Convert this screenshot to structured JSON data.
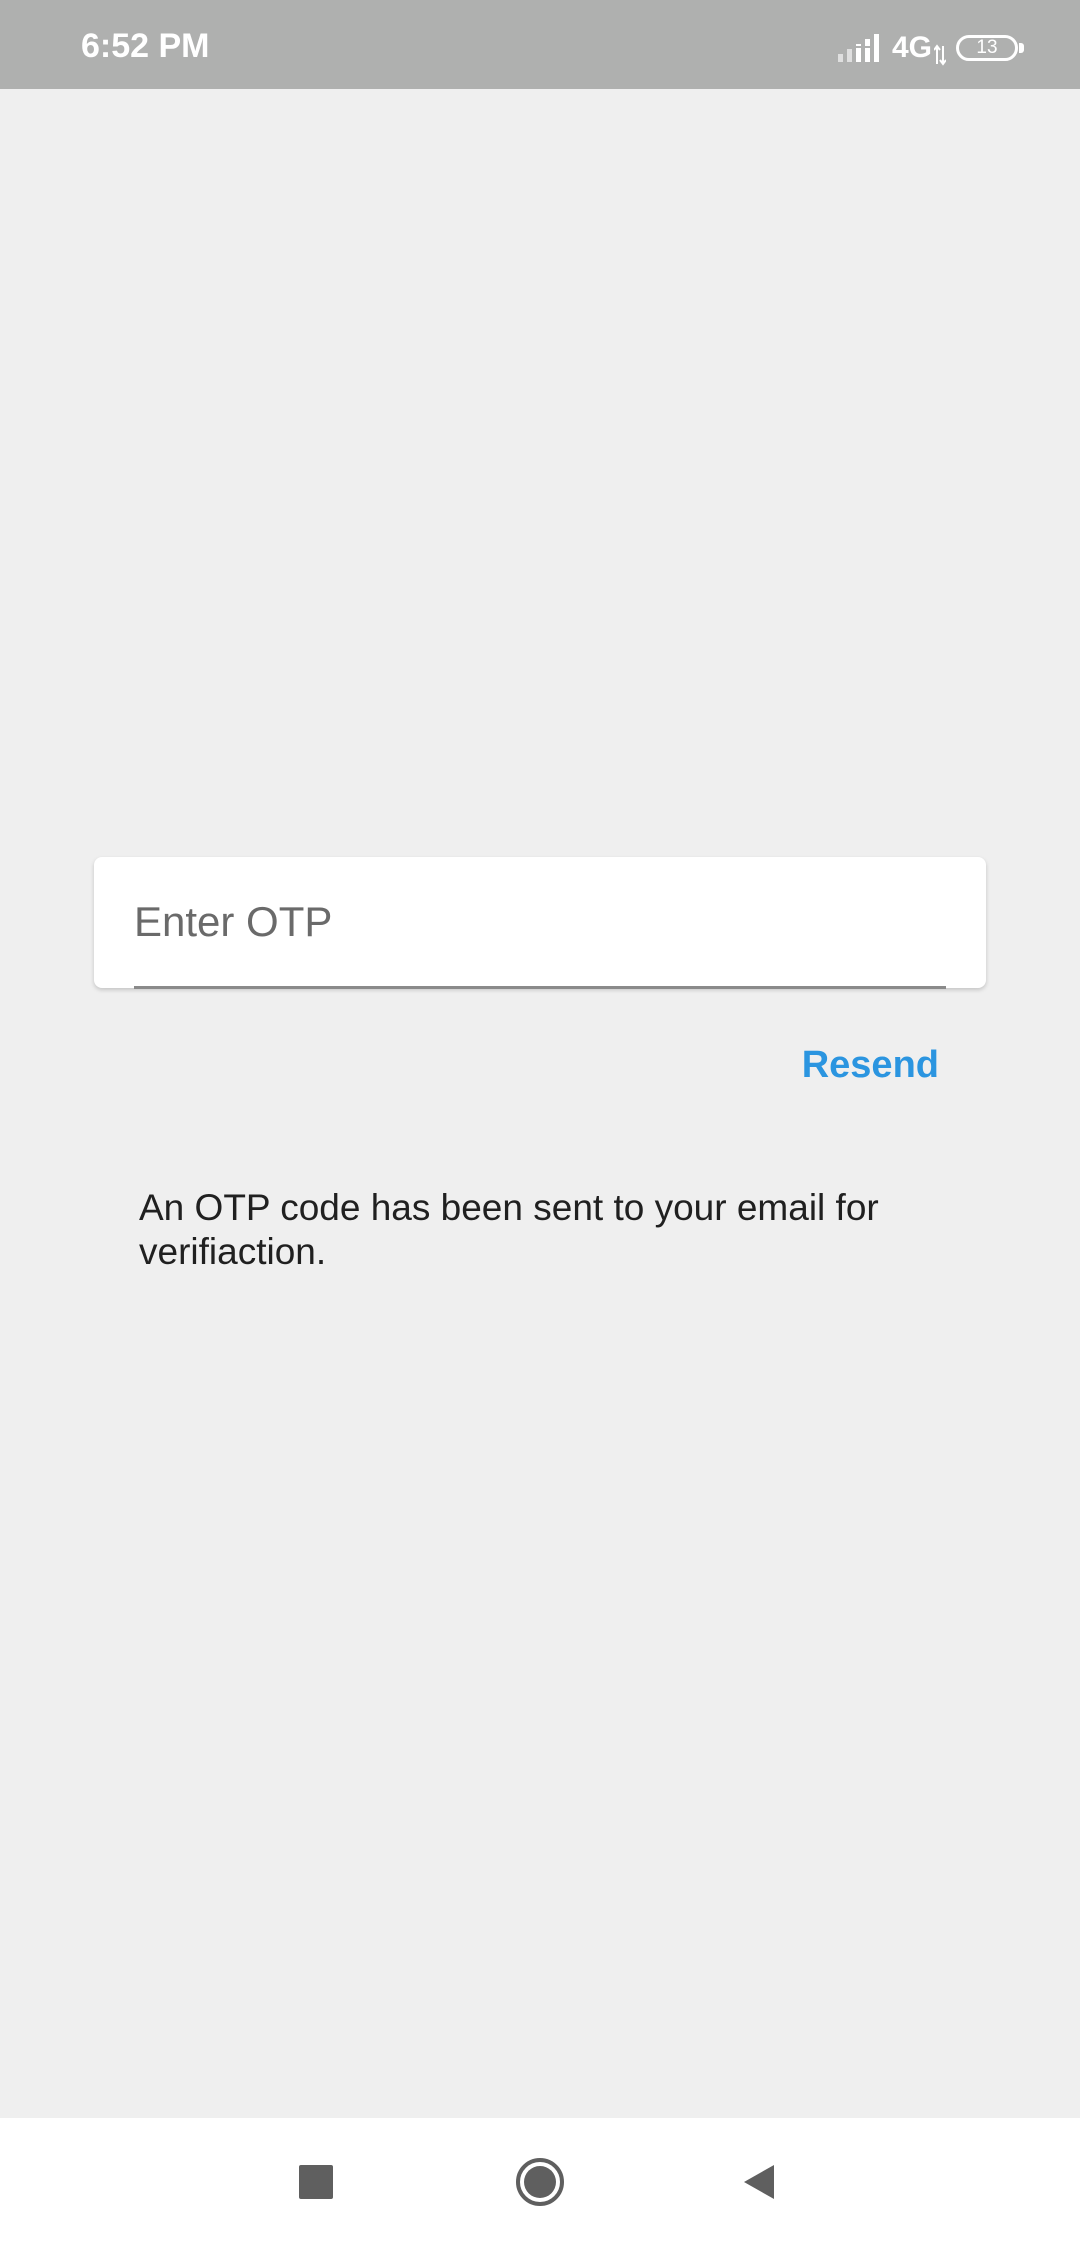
{
  "status_bar": {
    "time": "6:52 PM",
    "network": "4G",
    "battery_level": "13",
    "icons": [
      "signal-icon",
      "data-arrows-icon",
      "battery-icon"
    ]
  },
  "otp": {
    "placeholder": "Enter OTP",
    "value": ""
  },
  "resend": {
    "label": "Resend",
    "color": "#2b95e0"
  },
  "info": {
    "message": "An OTP code has been sent to your email for verifiaction."
  },
  "nav_bar": {
    "icons": [
      "recent-apps-icon",
      "home-icon",
      "back-icon"
    ]
  },
  "colors": {
    "status_bar_bg": "#afb0af",
    "page_bg": "#efefef",
    "accent": "#2b95e0"
  }
}
